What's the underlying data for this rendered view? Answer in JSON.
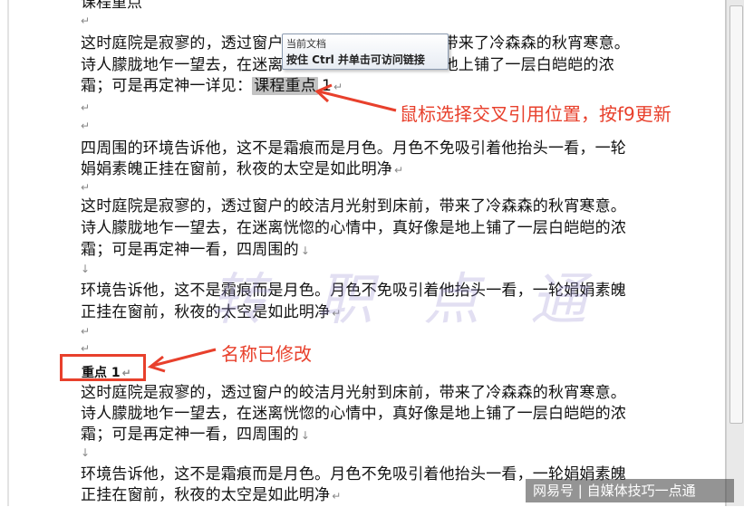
{
  "document": {
    "top_cut": "课程重点",
    "p1": [
      "这时庭院是寂寥的，透过窗户",
      "带来了冷森森的秋宵寒意。",
      "诗人朦胧地乍一望去，在迷离",
      "地上铺了一层白皑皑的浓",
      "霜；可是再定神一详见："
    ],
    "field_text": "课程重点",
    "field_num": "1",
    "p2": [
      "四周围的环境告诉他，这不是霜痕而是月色。月色不免吸引着他抬头一看，一轮",
      "娟娟素魄正挂在窗前，秋夜的太空是如此明净"
    ],
    "p3": [
      "这时庭院是寂寥的，透过窗户的皎洁月光射到床前，带来了冷森森的秋宵寒意。",
      "诗人朦胧地乍一望去，在迷离恍惚的心情中，真好像是地上铺了一层白皑皑的浓",
      "霜；可是再定神一看，四周围的"
    ],
    "p4": [
      "环境告诉他，这不是霜痕而是月色。月色不免吸引着他抬头一看，一轮娟娟素魄",
      "正挂在窗前，秋夜的太空是如此明净"
    ],
    "heading": "重点 1",
    "p5": [
      "这时庭院是寂寥的，透过窗户的皎洁月光射到床前，带来了冷森森的秋宵寒意。",
      "诗人朦胧地乍一望去，在迷离恍惚的心情中，真好像是地上铺了一层白皑皑的浓",
      "霜；可是再定神一看，四周围的"
    ],
    "p6": [
      "环境告诉他，这不是霜痕而是月色。月色不免吸引着他抬头一看，一轮娟娟素魄",
      "正挂在窗前，秋夜的太空是如此明净"
    ],
    "para_mark": "↵",
    "line_mark": "↓"
  },
  "tooltip": {
    "title": "当前文档",
    "body": "按住 Ctrl 并单击可访问链接"
  },
  "annotations": {
    "update_hint": "鼠标选择交叉引用位置，按f9更新",
    "renamed_hint": "名称已修改",
    "color": "#e8402c"
  },
  "watermark": "转  职  点  通",
  "banner": "网易号 | 自媒体技巧一点通"
}
